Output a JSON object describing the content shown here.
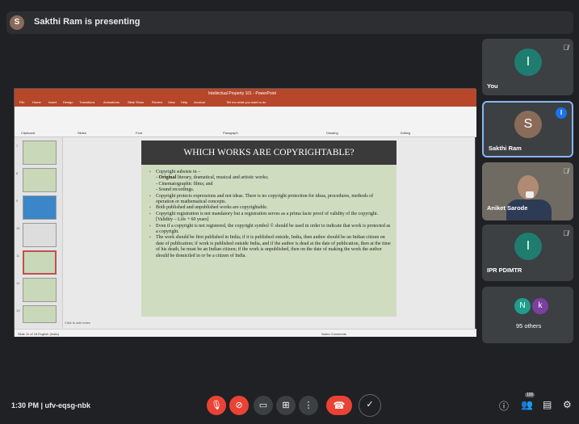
{
  "presenter": {
    "initial": "S",
    "text": "Sakthi Ram is presenting"
  },
  "ppt": {
    "title": "Intellectual Property 101 - PowerPoint",
    "tabs": [
      "File",
      "Home",
      "Insert",
      "Design",
      "Transitions",
      "Animations",
      "Slide Show",
      "Review",
      "View",
      "Help",
      "Acrobat",
      "Tell me what you want to do"
    ],
    "ribbon_labels": [
      "Clipboard",
      "Slides",
      "Font",
      "Paragraph",
      "Drawing",
      "Editing"
    ],
    "thumb_numbers": [
      "7",
      "8",
      "9",
      "10",
      "11",
      "12",
      "13"
    ],
    "notes_placeholder": "Click to add notes",
    "status_left": "Slide 11 of 18   English (India)",
    "status_right": "Notes   Comments"
  },
  "slide": {
    "title": "WHICH WORKS ARE COPYRIGHTABLE?",
    "p1": "Copyright subsists in –",
    "p1_sub1_bold": "Original",
    "p1_sub1_rest": " literary, dramatical, musical and artistic works;",
    "p1_sub2": "- Cinematographic films; and",
    "p1_sub3": "- Sound recordings.",
    "p2": "Copyright protects expressions and not ideas. There is no copyright protection for ideas, procedures, methods of operation or mathematical concepts.",
    "p3": "Both published and unpublished works are copyrightable.",
    "p4": "Copyright registration is not mandatory but a registration serves as a prima facie proof of validity of the copyright. [Validity – Life + 60 years]",
    "p5": "Even if a copyright is not registered, the copyright symbol © should be used in order to indicate that work is protected as a copyright.",
    "p6": "The work should be first published in India; if it is published outside, India, then author should be an Indian citizen on date of publication; if work is published outside India, and if the author is dead at the date of publication, then at the time of his death, he must be an Indian citizen; if the work is unpublished, then on the date of making the work the author should be domiciled in or be a citizen of India."
  },
  "tiles": {
    "you": {
      "initial": "I",
      "name": "You",
      "color": "#1e7d6e"
    },
    "sakthi": {
      "initial": "S",
      "name": "Sakthi Ram",
      "color": "#8a6b5a"
    },
    "aniket": {
      "name": "Aniket Sarode"
    },
    "ipr": {
      "initial": "I",
      "name": "IPR PDIMTR",
      "color": "#1e7d6e"
    },
    "others": {
      "a1": "N",
      "a1_color": "#1e9e8c",
      "a2": "k",
      "a2_color": "#7b3fa0",
      "label": "95 others"
    }
  },
  "bottom": {
    "time": "1:30 PM",
    "sep": " | ",
    "code": "ufv-eqsg-nbk",
    "participants_badge": "100"
  }
}
